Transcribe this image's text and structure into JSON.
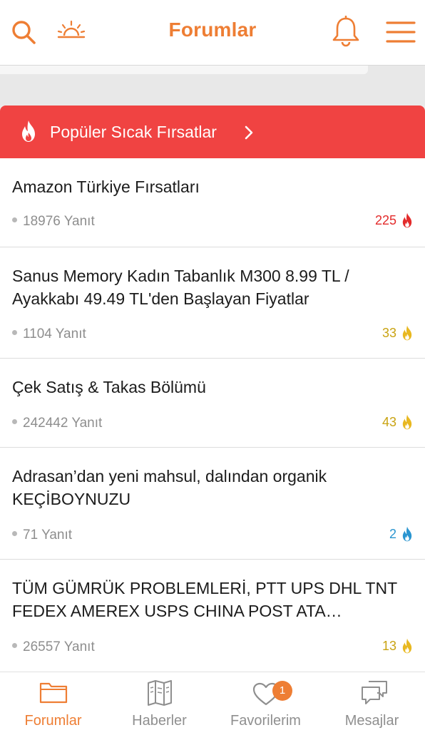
{
  "header": {
    "title": "Forumlar"
  },
  "banner": {
    "label": "Popüler Sıcak Fırsatlar"
  },
  "colors": {
    "accent": "#ee7e34",
    "banner_red": "#f04342",
    "heat_red": "#e32b2b",
    "heat_yellow": "#c9a312",
    "heat_blue": "#2a95d0"
  },
  "topics": [
    {
      "title": "Amazon Türkiye Fırsatları",
      "replies": "18976 Yanıt",
      "score": "225",
      "level": "red"
    },
    {
      "title": "Sanus Memory Kadın Tabanlık M300 8.99 TL / Ayakkabı 49.49 TL'den Başlayan Fiyatlar",
      "replies": "1104 Yanıt",
      "score": "33",
      "level": "yellow"
    },
    {
      "title": "Çek Satış & Takas Bölümü",
      "replies": "242442 Yanıt",
      "score": "43",
      "level": "yellow"
    },
    {
      "title": "Adrasan’dan yeni mahsul,  dalından organik KEÇİBOYNUZU",
      "replies": "71 Yanıt",
      "score": "2",
      "level": "blue"
    },
    {
      "title": "TÜM GÜMRÜK PROBLEMLERİ, PTT UPS DHL TNT FEDEX AMEREX USPS CHINA POST ATA…",
      "replies": "26557 Yanıt",
      "score": "13",
      "level": "yellow"
    }
  ],
  "nav": {
    "forumlar": "Forumlar",
    "haberler": "Haberler",
    "favorilerim": "Favorilerim",
    "favorilerim_badge": "1",
    "mesajlar": "Mesajlar"
  }
}
